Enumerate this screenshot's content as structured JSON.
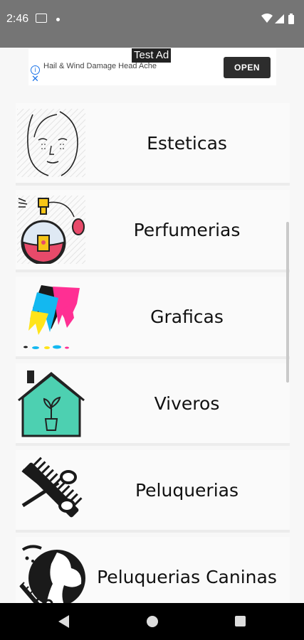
{
  "status_bar": {
    "time": "2:46",
    "icons": [
      "message-icon",
      "notification-dot-icon",
      "wifi-icon",
      "signal-icon",
      "battery-icon"
    ]
  },
  "ad": {
    "badge": "Test Ad",
    "text": "Hail & Wind Damage Head Ache",
    "button": "OPEN",
    "info_glyph": "i",
    "close_glyph": "✕"
  },
  "categories": [
    {
      "label": "Esteticas",
      "icon": "face-icon"
    },
    {
      "label": "Perfumerias",
      "icon": "perfume-bottle-icon"
    },
    {
      "label": "Graficas",
      "icon": "ink-splash-icon"
    },
    {
      "label": "Viveros",
      "icon": "greenhouse-icon"
    },
    {
      "label": "Peluquerias",
      "icon": "scissors-comb-icon"
    },
    {
      "label": "Peluquerias Caninas",
      "icon": "dog-grooming-icon"
    }
  ],
  "nav_bar": {
    "icons": [
      "back-icon",
      "home-icon",
      "recents-icon"
    ]
  }
}
